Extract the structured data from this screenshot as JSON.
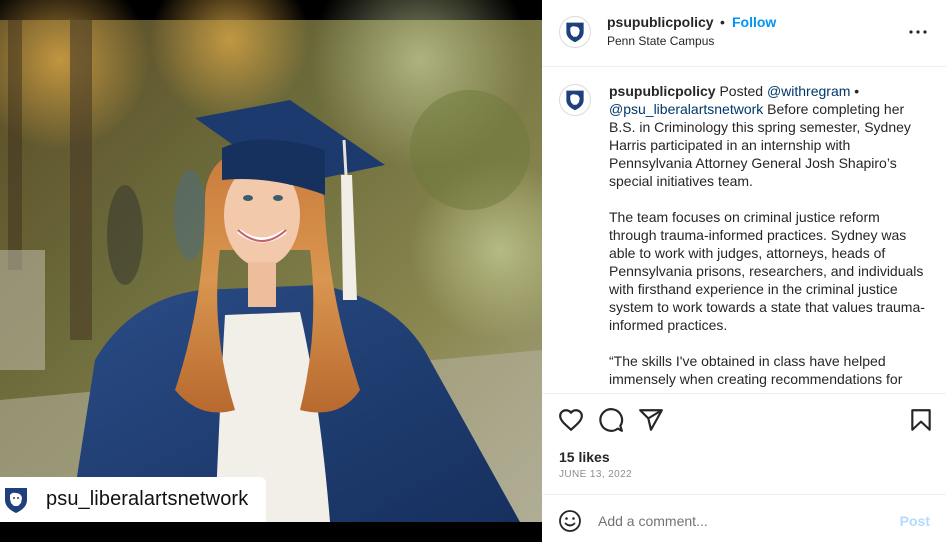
{
  "photo": {
    "repost_username": "psu_liberalartsnetwork",
    "logo_icon": "penn-state-nittany-lion-logo"
  },
  "header": {
    "username": "psupublicpolicy",
    "separator": "•",
    "follow_label": "Follow",
    "location": "Penn State Campus",
    "more_icon": "more-options-icon"
  },
  "caption": {
    "username": "psupublicpolicy",
    "posted_prefix": " Posted ",
    "credit_handle": "@withregram",
    "bullet": " •",
    "tagged_handle": "@psu_liberalartsnetwork",
    "paragraph1_rest": " Before completing her B.S. in Criminology this spring semester, Sydney Harris participated in an internship with Pennsylvania Attorney General Josh Shapiro’s special initiatives team.",
    "paragraph2": "The team focuses on criminal justice reform through trauma-informed practices. Sydney was able to work with judges, attorneys, heads of Pennsylvania prisons, researchers, and individuals with firsthand experience in the criminal justice system to work towards a state that values trauma-informed practices.",
    "paragraph3": "“The skills I've obtained in class have helped immensely when creating recommendations for"
  },
  "actions": {
    "like_icon": "heart-icon",
    "comment_icon": "comment-icon",
    "share_icon": "share-icon",
    "save_icon": "bookmark-icon"
  },
  "stats": {
    "likes": "15 likes",
    "date": "JUNE 13, 2022"
  },
  "comment": {
    "emoji_icon": "emoji-icon",
    "placeholder": "Add a comment...",
    "post_label": "Post"
  },
  "colors": {
    "accent": "#0095f6",
    "post_disabled": "#b3dbff",
    "link": "#00376b",
    "penn_state_navy": "#1e407c",
    "gown_navy": "#1f3d70"
  }
}
